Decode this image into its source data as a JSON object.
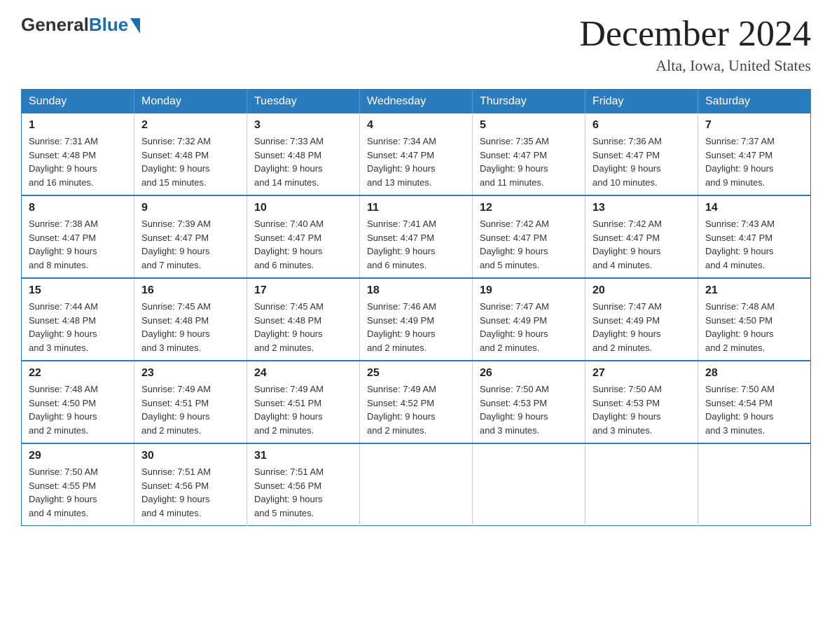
{
  "logo": {
    "general": "General",
    "blue": "Blue"
  },
  "title": "December 2024",
  "location": "Alta, Iowa, United States",
  "days_header": [
    "Sunday",
    "Monday",
    "Tuesday",
    "Wednesday",
    "Thursday",
    "Friday",
    "Saturday"
  ],
  "weeks": [
    [
      {
        "day": "1",
        "sunrise": "7:31 AM",
        "sunset": "4:48 PM",
        "daylight": "9 hours and 16 minutes."
      },
      {
        "day": "2",
        "sunrise": "7:32 AM",
        "sunset": "4:48 PM",
        "daylight": "9 hours and 15 minutes."
      },
      {
        "day": "3",
        "sunrise": "7:33 AM",
        "sunset": "4:48 PM",
        "daylight": "9 hours and 14 minutes."
      },
      {
        "day": "4",
        "sunrise": "7:34 AM",
        "sunset": "4:47 PM",
        "daylight": "9 hours and 13 minutes."
      },
      {
        "day": "5",
        "sunrise": "7:35 AM",
        "sunset": "4:47 PM",
        "daylight": "9 hours and 11 minutes."
      },
      {
        "day": "6",
        "sunrise": "7:36 AM",
        "sunset": "4:47 PM",
        "daylight": "9 hours and 10 minutes."
      },
      {
        "day": "7",
        "sunrise": "7:37 AM",
        "sunset": "4:47 PM",
        "daylight": "9 hours and 9 minutes."
      }
    ],
    [
      {
        "day": "8",
        "sunrise": "7:38 AM",
        "sunset": "4:47 PM",
        "daylight": "9 hours and 8 minutes."
      },
      {
        "day": "9",
        "sunrise": "7:39 AM",
        "sunset": "4:47 PM",
        "daylight": "9 hours and 7 minutes."
      },
      {
        "day": "10",
        "sunrise": "7:40 AM",
        "sunset": "4:47 PM",
        "daylight": "9 hours and 6 minutes."
      },
      {
        "day": "11",
        "sunrise": "7:41 AM",
        "sunset": "4:47 PM",
        "daylight": "9 hours and 6 minutes."
      },
      {
        "day": "12",
        "sunrise": "7:42 AM",
        "sunset": "4:47 PM",
        "daylight": "9 hours and 5 minutes."
      },
      {
        "day": "13",
        "sunrise": "7:42 AM",
        "sunset": "4:47 PM",
        "daylight": "9 hours and 4 minutes."
      },
      {
        "day": "14",
        "sunrise": "7:43 AM",
        "sunset": "4:47 PM",
        "daylight": "9 hours and 4 minutes."
      }
    ],
    [
      {
        "day": "15",
        "sunrise": "7:44 AM",
        "sunset": "4:48 PM",
        "daylight": "9 hours and 3 minutes."
      },
      {
        "day": "16",
        "sunrise": "7:45 AM",
        "sunset": "4:48 PM",
        "daylight": "9 hours and 3 minutes."
      },
      {
        "day": "17",
        "sunrise": "7:45 AM",
        "sunset": "4:48 PM",
        "daylight": "9 hours and 2 minutes."
      },
      {
        "day": "18",
        "sunrise": "7:46 AM",
        "sunset": "4:49 PM",
        "daylight": "9 hours and 2 minutes."
      },
      {
        "day": "19",
        "sunrise": "7:47 AM",
        "sunset": "4:49 PM",
        "daylight": "9 hours and 2 minutes."
      },
      {
        "day": "20",
        "sunrise": "7:47 AM",
        "sunset": "4:49 PM",
        "daylight": "9 hours and 2 minutes."
      },
      {
        "day": "21",
        "sunrise": "7:48 AM",
        "sunset": "4:50 PM",
        "daylight": "9 hours and 2 minutes."
      }
    ],
    [
      {
        "day": "22",
        "sunrise": "7:48 AM",
        "sunset": "4:50 PM",
        "daylight": "9 hours and 2 minutes."
      },
      {
        "day": "23",
        "sunrise": "7:49 AM",
        "sunset": "4:51 PM",
        "daylight": "9 hours and 2 minutes."
      },
      {
        "day": "24",
        "sunrise": "7:49 AM",
        "sunset": "4:51 PM",
        "daylight": "9 hours and 2 minutes."
      },
      {
        "day": "25",
        "sunrise": "7:49 AM",
        "sunset": "4:52 PM",
        "daylight": "9 hours and 2 minutes."
      },
      {
        "day": "26",
        "sunrise": "7:50 AM",
        "sunset": "4:53 PM",
        "daylight": "9 hours and 3 minutes."
      },
      {
        "day": "27",
        "sunrise": "7:50 AM",
        "sunset": "4:53 PM",
        "daylight": "9 hours and 3 minutes."
      },
      {
        "day": "28",
        "sunrise": "7:50 AM",
        "sunset": "4:54 PM",
        "daylight": "9 hours and 3 minutes."
      }
    ],
    [
      {
        "day": "29",
        "sunrise": "7:50 AM",
        "sunset": "4:55 PM",
        "daylight": "9 hours and 4 minutes."
      },
      {
        "day": "30",
        "sunrise": "7:51 AM",
        "sunset": "4:56 PM",
        "daylight": "9 hours and 4 minutes."
      },
      {
        "day": "31",
        "sunrise": "7:51 AM",
        "sunset": "4:56 PM",
        "daylight": "9 hours and 5 minutes."
      },
      null,
      null,
      null,
      null
    ]
  ],
  "labels": {
    "sunrise": "Sunrise:",
    "sunset": "Sunset:",
    "daylight": "Daylight:"
  }
}
